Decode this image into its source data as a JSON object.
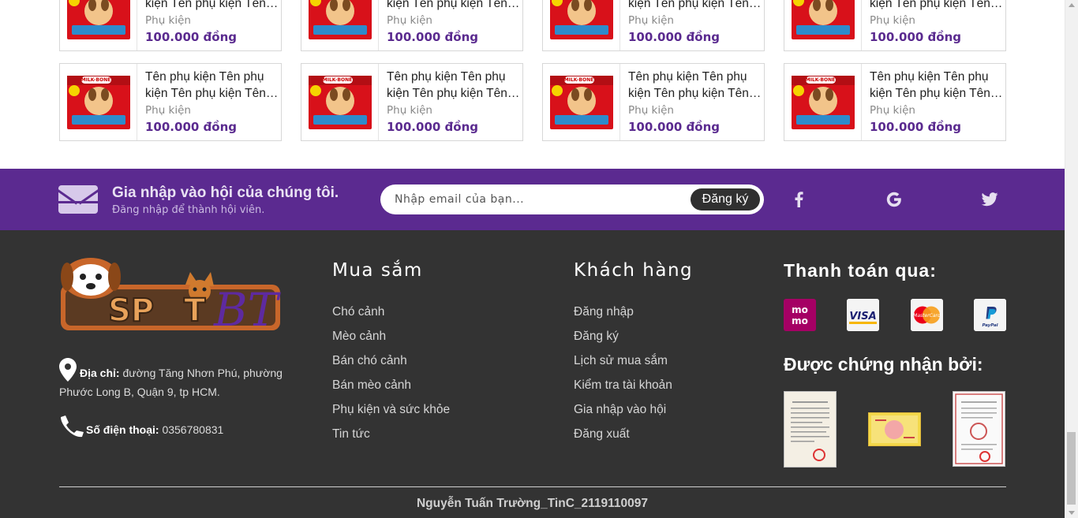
{
  "products": [
    {
      "name": "Tên phụ kiện Tên phụ kiện Tên phụ kiện Tên phụ kiện",
      "category": "Phụ kiện",
      "price": "100.000 đồng"
    },
    {
      "name": "Tên phụ kiện Tên phụ kiện Tên phụ kiện Tên phụ kiện",
      "category": "Phụ kiện",
      "price": "100.000 đồng"
    },
    {
      "name": "Tên phụ kiện Tên phụ kiện Tên phụ kiện Tên phụ kiện",
      "category": "Phụ kiện",
      "price": "100.000 đồng"
    },
    {
      "name": "Tên phụ kiện Tên phụ kiện Tên phụ kiện Tên phụ kiện",
      "category": "Phụ kiện",
      "price": "100.000 đồng"
    },
    {
      "name": "Tên phụ kiện Tên phụ kiện Tên phụ kiện Tên phụ kiện",
      "category": "Phụ kiện",
      "price": "100.000 đồng"
    },
    {
      "name": "Tên phụ kiện Tên phụ kiện Tên phụ kiện Tên phụ kiện",
      "category": "Phụ kiện",
      "price": "100.000 đồng"
    },
    {
      "name": "Tên phụ kiện Tên phụ kiện Tên phụ kiện Tên phụ kiện",
      "category": "Phụ kiện",
      "price": "100.000 đồng"
    },
    {
      "name": "Tên phụ kiện Tên phụ kiện Tên phụ kiện Tên phụ kiện",
      "category": "Phụ kiện",
      "price": "100.000 đồng"
    }
  ],
  "product_image": {
    "brand_text": "MILK-BONE"
  },
  "newsletter": {
    "title": "Gia nhập vào hội của chúng tôi.",
    "subtitle": "Đăng nhập để thành hội viên.",
    "email_placeholder": "Nhập email của bạn...",
    "submit_label": "Đăng ký",
    "social_icons": [
      "facebook-icon",
      "google-icon",
      "twitter-icon"
    ]
  },
  "footer": {
    "logo_text": "SPOTBT",
    "address_label": "Địa chỉ:",
    "address_value": "đường Tăng Nhơn Phú, phường Phước Long B, Quận 9, tp HCM.",
    "phone_label": "Số điện thoại:",
    "phone_value": "0356780831",
    "shop": {
      "title": "Mua sắm",
      "links": [
        "Chó cảnh",
        "Mèo cảnh",
        "Bán chó cảnh",
        "Bán mèo cảnh",
        "Phụ kiện và sức khỏe",
        "Tin tức"
      ]
    },
    "customer": {
      "title": "Khách hàng",
      "links": [
        "Đăng nhập",
        "Đăng ký",
        "Lịch sử mua sắm",
        "Kiểm tra tài khoản",
        "Gia nhập vào hội",
        "Đăng xuất"
      ]
    },
    "payment": {
      "title": "Thanh toán qua:",
      "methods": [
        "momo",
        "VISA",
        "MasterCard",
        "PayPal"
      ]
    },
    "certified_title": "Được chứng nhận bởi:",
    "copyright": "Nguyễn Tuấn Trường_TinC_2119110097"
  },
  "colors": {
    "brand_purple": "#5b2a90",
    "footer_bg": "#333333",
    "price": "#5a2a8f"
  }
}
